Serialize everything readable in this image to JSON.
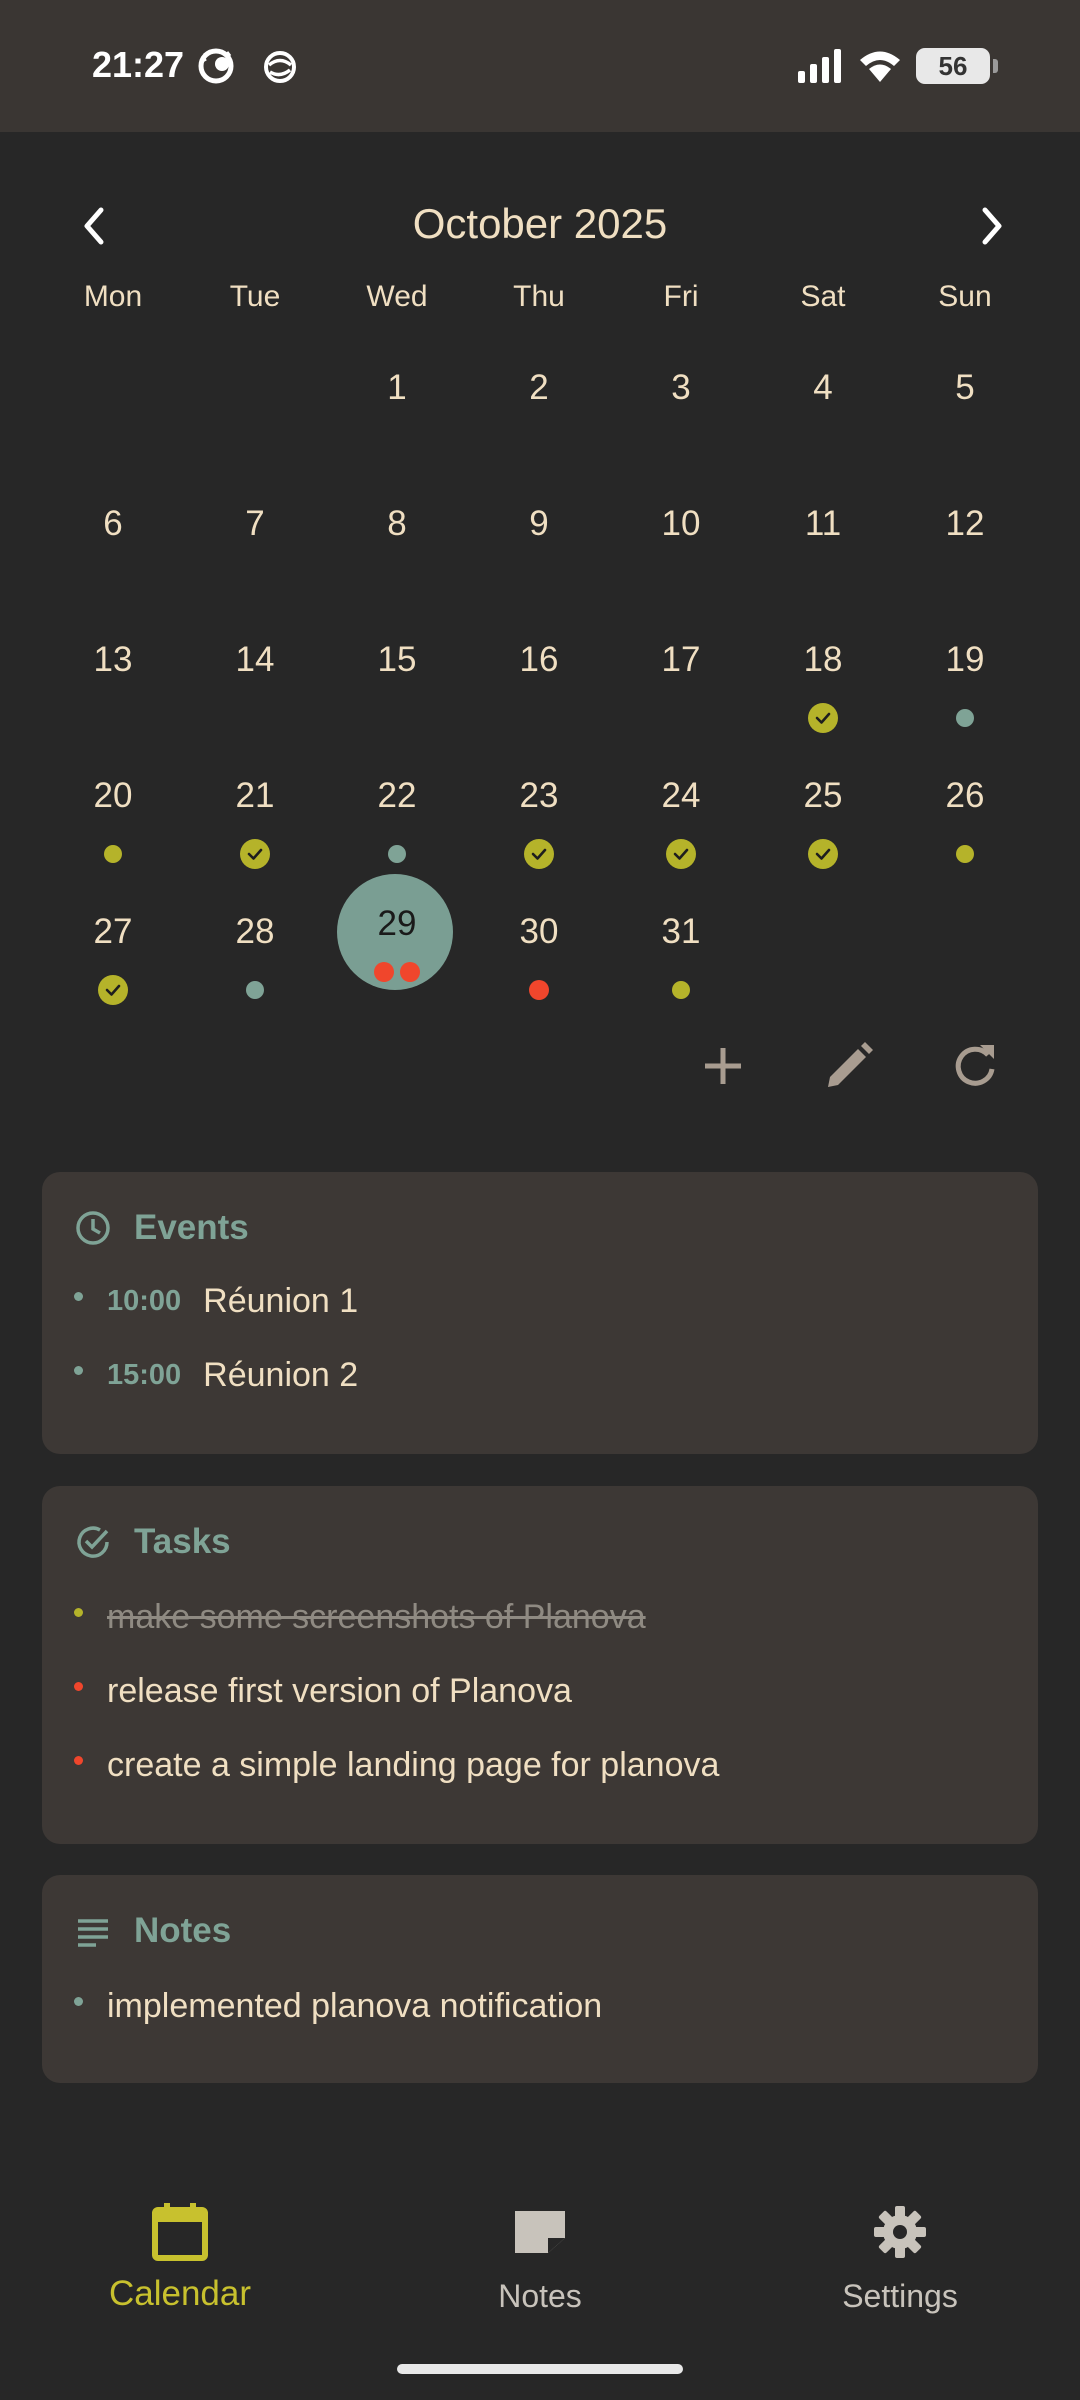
{
  "status_bar": {
    "time": "21:27",
    "battery": "56",
    "icons": [
      "app-notification-icon",
      "globe-sync-icon",
      "signal-icon",
      "wifi-icon",
      "battery-icon"
    ]
  },
  "calendar": {
    "month_title": "October 2025",
    "prev_icon": "chevron-left-icon",
    "next_icon": "chevron-right-icon",
    "weekdays": [
      "Mon",
      "Tue",
      "Wed",
      "Thu",
      "Fri",
      "Sat",
      "Sun"
    ],
    "first_weekday_index": 2,
    "days_in_month": 31,
    "selected_day": 29,
    "markers": {
      "18": [
        "check"
      ],
      "19": [
        "teal"
      ],
      "20": [
        "olive"
      ],
      "21": [
        "check"
      ],
      "22": [
        "teal"
      ],
      "23": [
        "check"
      ],
      "24": [
        "check"
      ],
      "25": [
        "check"
      ],
      "26": [
        "olive"
      ],
      "27": [
        "check"
      ],
      "28": [
        "teal"
      ],
      "29": [
        "red",
        "red"
      ],
      "30": [
        "red"
      ],
      "31": [
        "olive"
      ]
    }
  },
  "actions": {
    "add_icon": "plus-icon",
    "edit_icon": "pencil-icon",
    "refresh_icon": "refresh-icon"
  },
  "events": {
    "title": "Events",
    "icon": "clock-icon",
    "items": [
      {
        "time": "10:00",
        "label": "Réunion 1"
      },
      {
        "time": "15:00",
        "label": "Réunion 2"
      }
    ]
  },
  "tasks": {
    "title": "Tasks",
    "icon": "check-circle-icon",
    "items": [
      {
        "label": "make some screenshots of Planova",
        "done": true
      },
      {
        "label": "release first version of Planova",
        "done": false
      },
      {
        "label": "create a simple landing page for planova",
        "done": false
      }
    ]
  },
  "notes": {
    "title": "Notes",
    "icon": "lines-icon",
    "items": [
      {
        "label": "implemented planova notification"
      }
    ]
  },
  "bottom_nav": {
    "tabs": [
      {
        "label": "Calendar",
        "icon": "calendar-icon",
        "active": true
      },
      {
        "label": "Notes",
        "icon": "note-icon",
        "active": false
      },
      {
        "label": "Settings",
        "icon": "gear-icon",
        "active": false
      }
    ]
  },
  "colors": {
    "background": "#272727",
    "card": "#3d3835",
    "text": "#f0dfc2",
    "teal": "#7fa396",
    "olive": "#b5b32a",
    "red": "#f0462c",
    "active_tab": "#c8c12e"
  }
}
